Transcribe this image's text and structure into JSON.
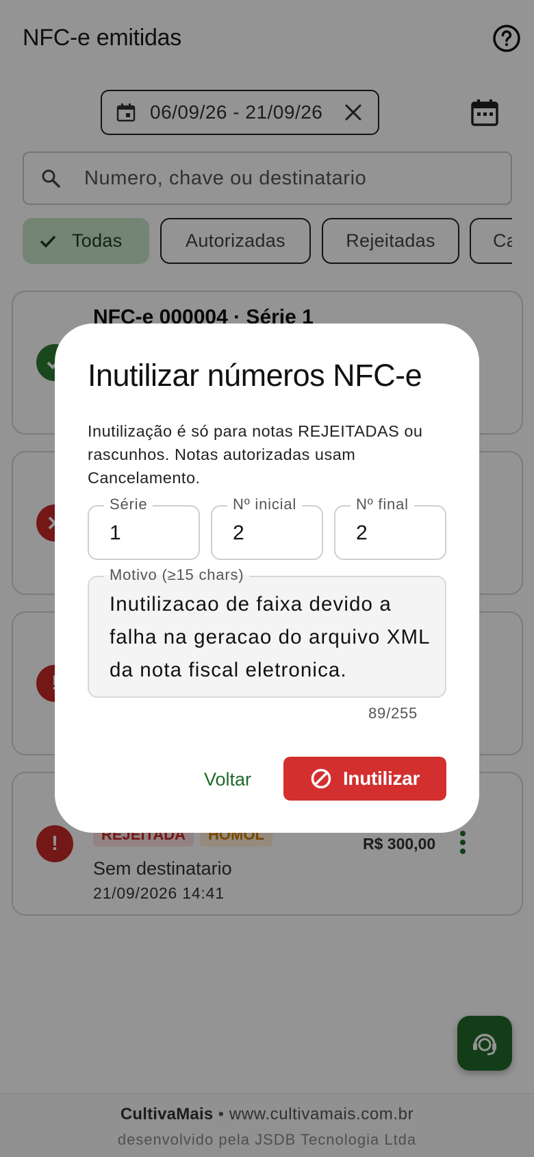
{
  "screen": {
    "title": "NFC-e emitidas",
    "date_range": "06/09/26 - 21/09/26",
    "search_placeholder": "Numero, chave ou destinatario"
  },
  "filters": [
    {
      "label": "Todas",
      "selected": true
    },
    {
      "label": "Autorizadas",
      "selected": false
    },
    {
      "label": "Rejeitadas",
      "selected": false
    },
    {
      "label": "Ca",
      "selected": false
    }
  ],
  "cards": {
    "first_title": "NFC-e 000004 · Série 1",
    "last": {
      "badge_status": "REJEITADA",
      "badge_env": "HOMOL",
      "amount": "R$ 300,00",
      "recipient": "Sem destinatario",
      "datetime": "21/09/2026 14:41"
    }
  },
  "footer": {
    "brand": "CultivaMais",
    "site": " • www.cultivamais.com.br",
    "credit": "desenvolvido pela JSDB Tecnologia Ltda"
  },
  "dialog": {
    "title": "Inutilizar números NFC-e",
    "description": "Inutilização é só para notas REJEITADAS ou rascunhos. Notas autorizadas usam Cancelamento.",
    "serie_label": "Série",
    "serie_value": "1",
    "inicial_label": "Nº inicial",
    "inicial_value": "2",
    "final_label": "Nº final",
    "final_value": "2",
    "motivo_label": "Motivo (≥15 chars)",
    "motivo_value": "Inutilizacao de faixa devido a falha na geracao do arquivo XML da nota fiscal eletronica.",
    "counter": "89/255",
    "cancel_label": "Voltar",
    "confirm_label": "Inutilizar"
  },
  "colors": {
    "primary_green": "#1f6a2a",
    "selected_chip": "#c8e6c9",
    "danger_red": "#d32f2f",
    "rejected_badge_bg": "#fde0e0",
    "homol_badge_bg": "#fff0d6"
  },
  "icons": [
    "help-icon",
    "calendar-icon",
    "close-icon",
    "calendar-month-icon",
    "search-icon",
    "check-icon",
    "status-ok-icon",
    "status-error-icon",
    "status-alert-icon",
    "more-vert-icon",
    "support-agent-icon",
    "block-icon"
  ]
}
